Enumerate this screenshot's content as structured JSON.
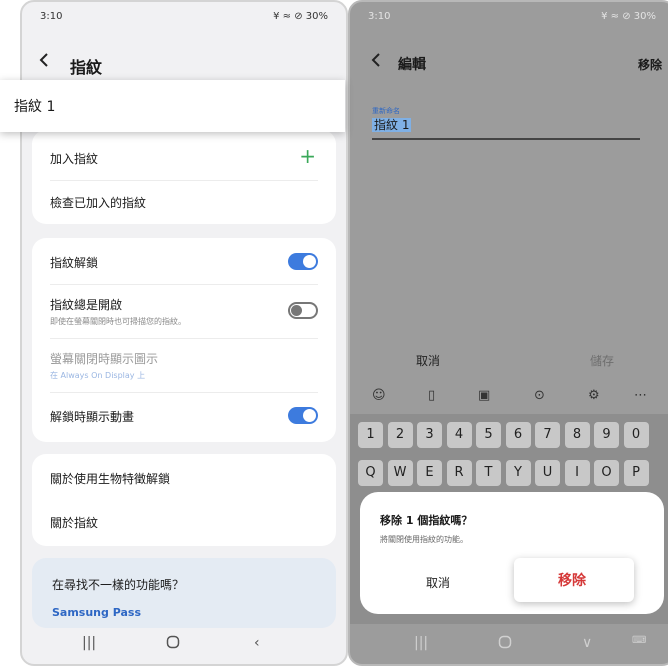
{
  "status": {
    "time": "3:10",
    "left_icons": "■ ⚙ ☁ •",
    "right_text": "¥ ≈ ⊘ 30%"
  },
  "left": {
    "title": "指紋",
    "banner_label": "指紋 1",
    "card1": {
      "add": "加入指紋",
      "check": "檢查已加入的指紋"
    },
    "card2": {
      "unlock": "指紋解鎖",
      "always_on": "指紋總是開啟",
      "always_on_sub": "即使在螢幕關閉時也可掃描您的指紋。",
      "screen_off": "螢幕關閉時顯示圖示",
      "screen_off_sub": "在 Always On Display 上",
      "animation": "解鎖時顯示動畫"
    },
    "card3": {
      "biometric": "關於使用生物特徵解鎖",
      "about": "關於指紋"
    },
    "suggest": {
      "title": "在尋找不一樣的功能嗎？",
      "link": "Samsung Pass"
    },
    "toggles": {
      "unlock": true,
      "always_on": false,
      "animation": true
    }
  },
  "right": {
    "title": "編輯",
    "remove": "移除",
    "field_label": "重新命名",
    "field_value": "指紋 1",
    "cancel": "取消",
    "save": "儲存",
    "keys_row1": [
      "1",
      "2",
      "3",
      "4",
      "5",
      "6",
      "7",
      "8",
      "9",
      "0"
    ],
    "keys_row2": [
      "Q",
      "W",
      "E",
      "R",
      "T",
      "Y",
      "U",
      "I",
      "O",
      "P"
    ],
    "dialog": {
      "title": "移除 1 個指紋嗎？",
      "desc": "將關閉使用指紋的功能。",
      "cancel": "取消",
      "remove": "移除"
    }
  },
  "colors": {
    "accent_blue": "#3d7bde",
    "green_plus": "#3aa859",
    "danger": "#d53838"
  }
}
